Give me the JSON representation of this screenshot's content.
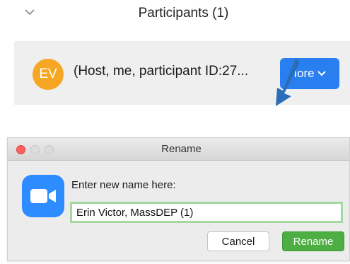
{
  "participants_panel": {
    "title": "Participants (1)",
    "collapse_icon": "chevron-down-icon",
    "participant": {
      "initials": "EV",
      "avatar_color": "#f5a623",
      "label": "(Host, me, participant ID:27...",
      "more_button": "Iore"
    },
    "accent": "#2a7ff0"
  },
  "rename_dialog": {
    "title": "Rename",
    "app_icon": "zoom-camera-icon",
    "prompt": "Enter new name here:",
    "name_value": "Erin Victor, MassDEP (1)",
    "cancel_label": "Cancel",
    "rename_label": "Rename",
    "rename_color": "#4cae43"
  }
}
